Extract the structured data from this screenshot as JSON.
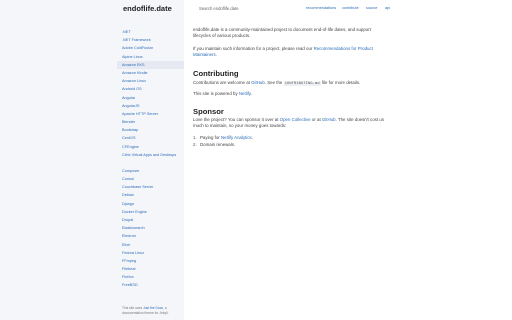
{
  "header": {
    "logo": "endoflife.date",
    "search_placeholder": "Search endoflife.date",
    "links": [
      "recommendations",
      "contribute",
      "source",
      "api"
    ]
  },
  "sidebar": {
    "items": [
      ".NET",
      ".NET Framework",
      "Adobe ColdFusion",
      "Alpine Linux",
      "Amazon EKS",
      "Amazon Kindle",
      "Amazon Linux",
      "Android OS",
      "Angular",
      "AngularJS",
      "Apache HTTP Server",
      "Blender",
      "Bootstrap",
      "CentOS",
      "CFEngine",
      "Citrix Virtual Apps and Desktops",
      "Composer",
      "Consul",
      "Couchbase Server",
      "Debian",
      "Django",
      "Docker Engine",
      "Drupal",
      "Elasticsearch",
      "Electron",
      "Elixir",
      "Fedora Linux",
      "FFmpeg",
      "Filebeat",
      "Firefox",
      "FreeBSD"
    ],
    "active_index": 4,
    "footer_prefix": "This site uses ",
    "footer_link": "Just the Docs",
    "footer_suffix": ", a documentation theme for Jekyll."
  },
  "main": {
    "intro": "endoflife.date is a community-maintained project to document end-of-life dates, and support lifecycles of various products.",
    "maintain_prefix": "If you maintain such information for a project, please read our ",
    "maintain_link": "Recommendations for Product Maintainers",
    "maintain_suffix": ".",
    "contributing_heading": "Contributing",
    "contrib_prefix": "Contributions are welcome at ",
    "contrib_link": "GitHub",
    "contrib_mid": ". See the ",
    "contrib_code": "CONTRIBUTING.md",
    "contrib_suffix": " file for more details.",
    "powered_prefix": "This site is powered by ",
    "powered_link": "Netlify",
    "powered_suffix": ".",
    "sponsor_heading": "Sponsor",
    "sponsor_prefix": "Love the project? You can sponsor it over at ",
    "sponsor_link1": "Open Collective",
    "sponsor_mid": " or at ",
    "sponsor_link2": "GitHub",
    "sponsor_suffix": ". The site doesn't cost us much to maintain, so your money goes towards:",
    "list": [
      {
        "num": "1.",
        "prefix": "Paying for ",
        "link": "Netlify Analytics",
        "suffix": "."
      },
      {
        "num": "2.",
        "prefix": "Domain renewals.",
        "link": "",
        "suffix": ""
      }
    ]
  }
}
